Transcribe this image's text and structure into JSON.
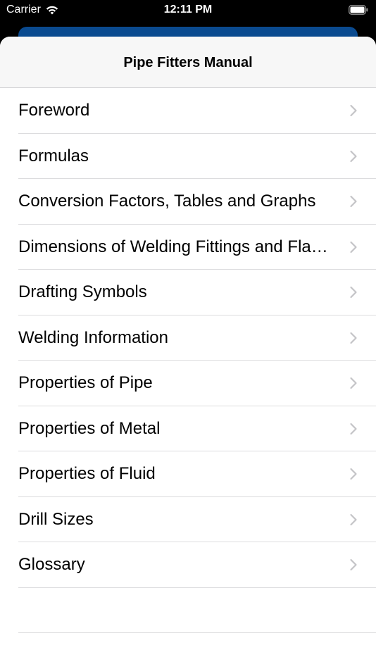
{
  "status_bar": {
    "carrier": "Carrier",
    "time": "12:11 PM"
  },
  "nav": {
    "title": "Pipe Fitters Manual"
  },
  "menu": {
    "items": [
      {
        "label": "Foreword",
        "icon": "chevron-right-icon"
      },
      {
        "label": "Formulas",
        "icon": "chevron-right-icon"
      },
      {
        "label": "Conversion Factors, Tables and Graphs",
        "icon": "chevron-right-icon"
      },
      {
        "label": "Dimensions of Welding Fittings and Fla…",
        "icon": "chevron-right-icon"
      },
      {
        "label": "Drafting Symbols",
        "icon": "chevron-right-icon"
      },
      {
        "label": "Welding Information",
        "icon": "chevron-right-icon"
      },
      {
        "label": "Properties of Pipe",
        "icon": "chevron-right-icon"
      },
      {
        "label": "Properties of Metal",
        "icon": "chevron-right-icon"
      },
      {
        "label": "Properties of Fluid",
        "icon": "chevron-right-icon"
      },
      {
        "label": "Drill Sizes",
        "icon": "chevron-right-icon"
      },
      {
        "label": "Glossary",
        "icon": "chevron-right-icon"
      }
    ]
  },
  "colors": {
    "accent_behind": "#0a4a8f",
    "chevron": "#c4c4c7",
    "separator": "#dcdcde",
    "nav_background": "#f7f7f7"
  }
}
